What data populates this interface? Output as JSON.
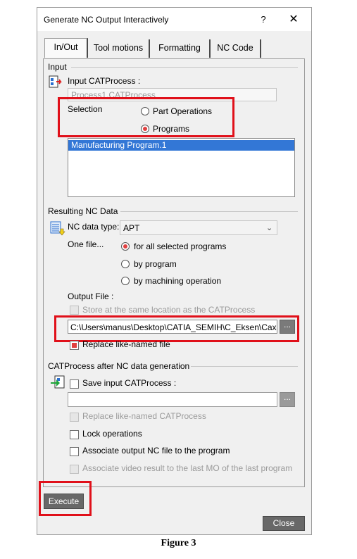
{
  "window": {
    "title": "Generate NC Output Interactively",
    "help": "?",
    "close": "✕"
  },
  "tabs": [
    "In/Out",
    "Tool motions",
    "Formatting",
    "NC Code"
  ],
  "input": {
    "section": "Input",
    "catprocess_label": "Input CATProcess :",
    "catprocess_value": "Process1.CATProcess",
    "selection_label": "Selection",
    "options": [
      "Part Operations",
      "Programs"
    ],
    "selected_option": "Programs",
    "list_items": [
      "Manufacturing Program.1"
    ]
  },
  "nc_data": {
    "section": "Resulting NC Data",
    "type_label": "NC data type:",
    "type_value": "APT",
    "one_file_label": "One file...",
    "one_file_options": [
      "for all selected programs",
      "by program",
      "by machining operation"
    ],
    "one_file_selected": "for all selected programs",
    "output_file_label": "Output File :",
    "store_same_location": "Store at the same location as the CATProcess",
    "output_path": "C:\\Users\\manus\\Desktop\\CATIA_SEMIH\\C_Eksen\\Cax",
    "browse": "...",
    "replace_like_named": "Replace like-named file"
  },
  "after": {
    "section": "CATProcess after NC data generation",
    "save_input": "Save input CATProcess :",
    "path_value": "",
    "browse": "...",
    "replace_like_named": "Replace like-named CATProcess",
    "lock_operations": "Lock operations",
    "associate_nc": "Associate output NC file to the program",
    "associate_video": "Associate video result to the last MO of the last program"
  },
  "buttons": {
    "execute": "Execute",
    "close": "Close"
  },
  "caption": "Figure 3",
  "colors": {
    "highlight_red": "#e0101a",
    "selection_blue": "#3377d6",
    "button_gray": "#686868"
  }
}
